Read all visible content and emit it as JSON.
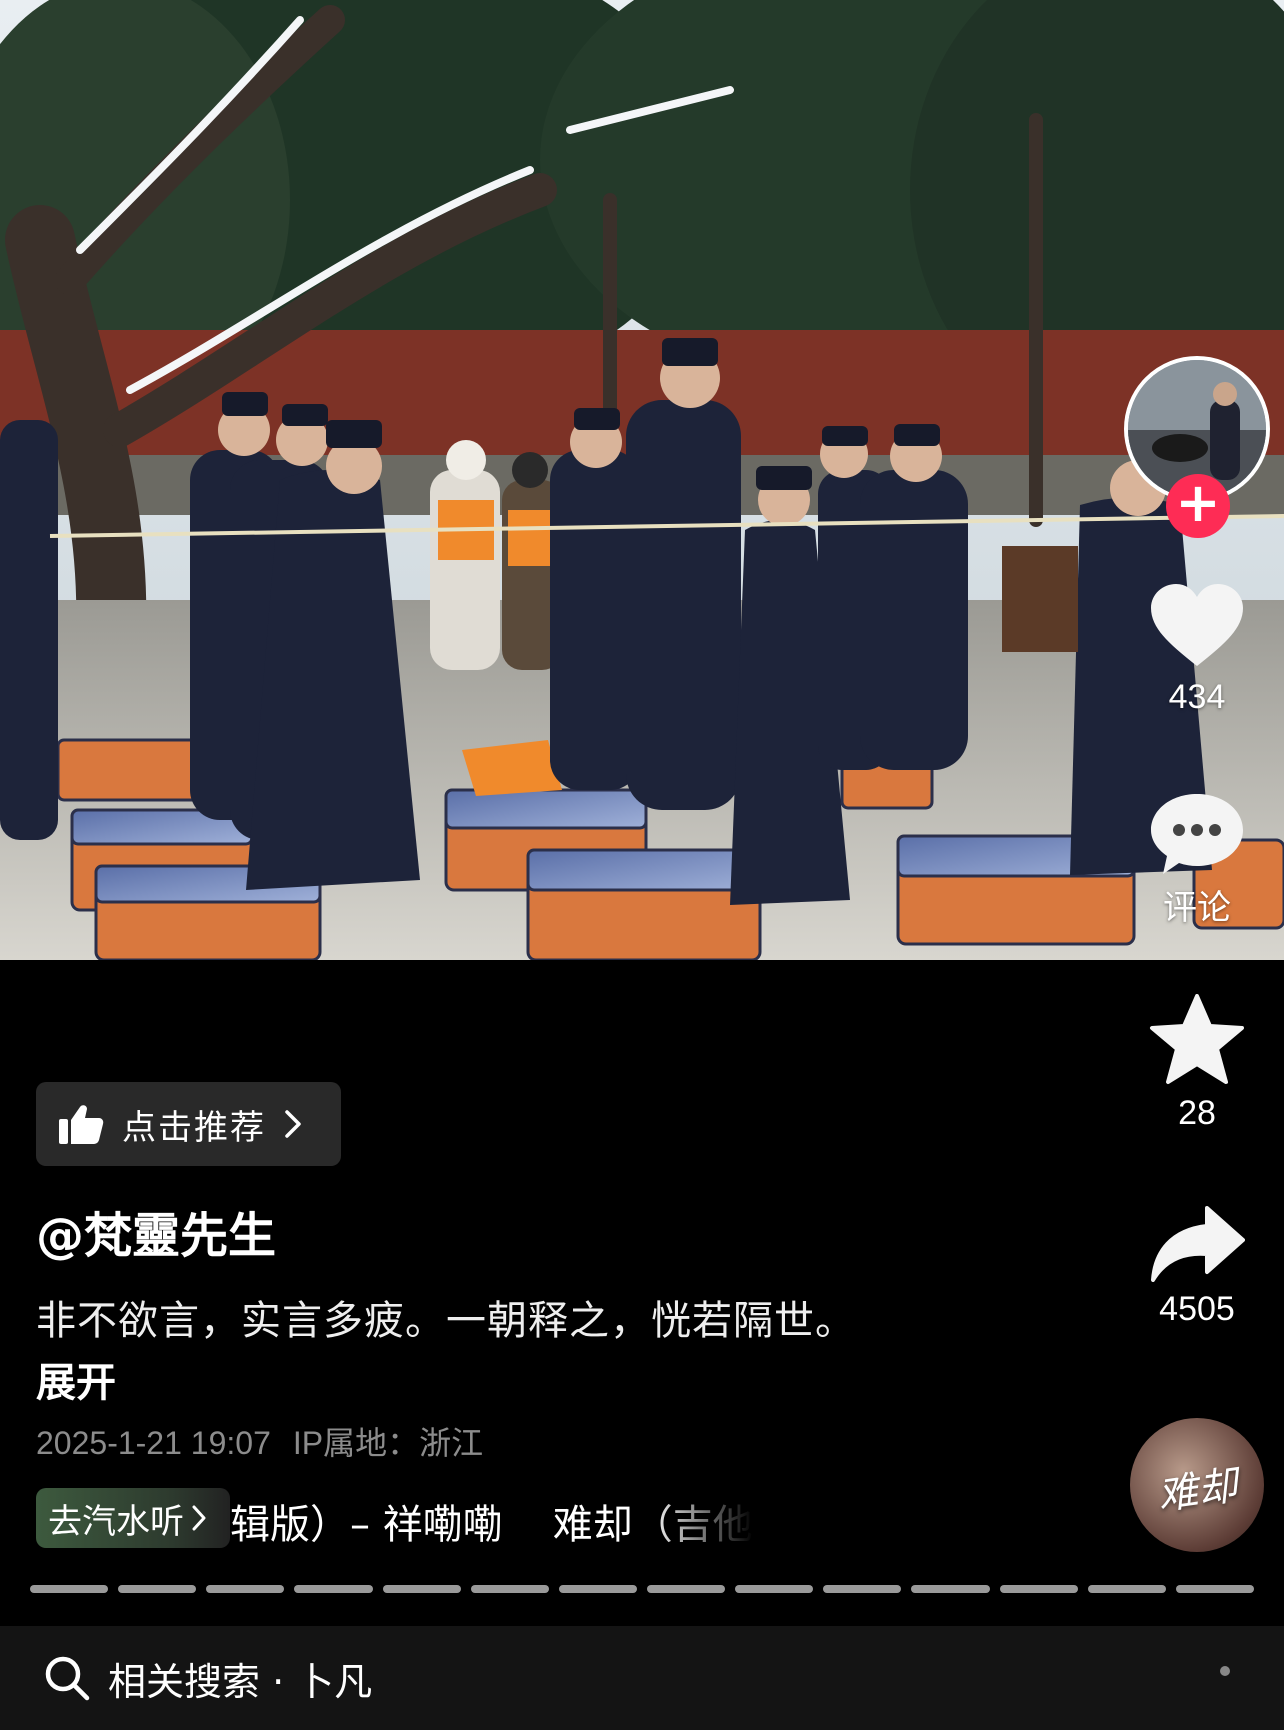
{
  "actions": {
    "like_count": "434",
    "comment_label": "评论",
    "favorite_count": "28",
    "share_count": "4505"
  },
  "info": {
    "recommend_label": "点击推荐",
    "author": "@梵靈先生",
    "caption": "非不欲言，实言多疲。一朝释之，恍若隔世。",
    "expand_label": "展开",
    "date": "2025-1-21 19:07",
    "ip_location": "IP属地：浙江"
  },
  "music": {
    "listen_button": "去汽水听",
    "song_title_1": "辑版）– 祥嘞嘞",
    "song_title_2": "难却（吉他",
    "disc_text": "难却"
  },
  "progress": {
    "segments": 14
  },
  "search": {
    "text": "相关搜索 · 卜凡"
  },
  "colors": {
    "follow": "#fe2c55",
    "background": "#000000",
    "meta": "#8c8c8c"
  },
  "icons": [
    "follow-plus-icon",
    "heart-icon",
    "comment-icon",
    "star-icon",
    "share-icon",
    "thumbs-up-icon",
    "chevron-right-icon",
    "search-icon"
  ]
}
